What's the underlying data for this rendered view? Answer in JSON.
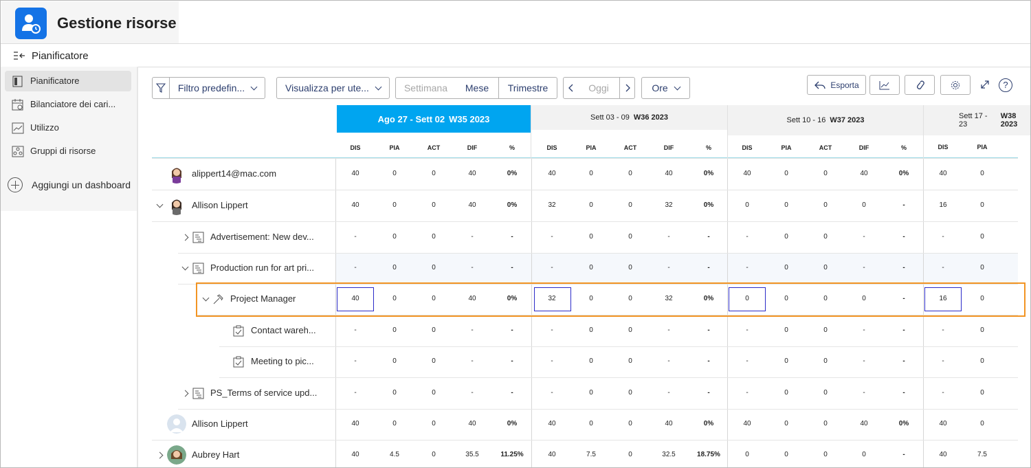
{
  "app": {
    "title": "Gestione risorse",
    "page_title": "Pianificatore"
  },
  "sidebar": {
    "items": [
      {
        "label": "Pianificatore",
        "icon": "planner-icon",
        "active": true
      },
      {
        "label": "Bilanciatore dei cari...",
        "icon": "calendar-icon",
        "active": false
      },
      {
        "label": "Utilizzo",
        "icon": "chart-line-icon",
        "active": false
      },
      {
        "label": "Gruppi di risorse",
        "icon": "resource-groups-icon",
        "active": false
      }
    ],
    "add_dashboard": "Aggiungi un dashboard"
  },
  "toolbar": {
    "filter": "Filtro predefin...",
    "view": "Visualizza per ute...",
    "settimana": "Settimana",
    "mese": "Mese",
    "trimestre": "Trimestre",
    "oggi": "Oggi",
    "unit": "Ore",
    "export": "Esporta"
  },
  "weeks": [
    {
      "range": "Ago 27 - Sett 02",
      "code": "W35 2023",
      "current": true
    },
    {
      "range": "Sett 03 - 09",
      "code": "W36 2023",
      "current": false
    },
    {
      "range": "Sett 10 - 16",
      "code": "W37 2023",
      "current": false
    },
    {
      "range": "Sett 17 - 23",
      "code": "W38 2023",
      "current": false
    }
  ],
  "columns": [
    "DIS",
    "PIA",
    "ACT",
    "DIF",
    "%"
  ],
  "rows": [
    {
      "label": "alippert14@mac.com",
      "type": "user",
      "values": [
        [
          "40",
          "0",
          "0",
          "40",
          "0%"
        ],
        [
          "40",
          "0",
          "0",
          "40",
          "0%"
        ],
        [
          "40",
          "0",
          "0",
          "40",
          "0%"
        ],
        [
          "40",
          "0",
          "",
          "",
          ""
        ]
      ]
    },
    {
      "label": "Allison Lippert",
      "type": "user",
      "values": [
        [
          "40",
          "0",
          "0",
          "40",
          "0%"
        ],
        [
          "32",
          "0",
          "0",
          "32",
          "0%"
        ],
        [
          "0",
          "0",
          "0",
          "0",
          "-"
        ],
        [
          "16",
          "0",
          "",
          "",
          ""
        ]
      ]
    },
    {
      "label": "Advertisement: New dev...",
      "type": "project",
      "values": [
        [
          "-",
          "0",
          "0",
          "-",
          "-"
        ],
        [
          "-",
          "0",
          "0",
          "-",
          "-"
        ],
        [
          "-",
          "0",
          "0",
          "-",
          "-"
        ],
        [
          "-",
          "0",
          "",
          "",
          ""
        ]
      ]
    },
    {
      "label": "Production run for art pri...",
      "type": "project",
      "values": [
        [
          "-",
          "0",
          "0",
          "-",
          "-"
        ],
        [
          "-",
          "0",
          "0",
          "-",
          "-"
        ],
        [
          "-",
          "0",
          "0",
          "-",
          "-"
        ],
        [
          "-",
          "0",
          "",
          "",
          ""
        ]
      ]
    },
    {
      "label": "Project Manager",
      "type": "role",
      "values": [
        [
          "40",
          "0",
          "0",
          "40",
          "0%"
        ],
        [
          "32",
          "0",
          "0",
          "32",
          "0%"
        ],
        [
          "0",
          "0",
          "0",
          "0",
          "-"
        ],
        [
          "16",
          "0",
          "",
          "",
          ""
        ]
      ]
    },
    {
      "label": "Contact wareh...",
      "type": "task",
      "values": [
        [
          "-",
          "0",
          "0",
          "-",
          "-"
        ],
        [
          "-",
          "0",
          "0",
          "-",
          "-"
        ],
        [
          "-",
          "0",
          "0",
          "-",
          "-"
        ],
        [
          "-",
          "0",
          "",
          "",
          ""
        ]
      ]
    },
    {
      "label": "Meeting to pic...",
      "type": "task",
      "values": [
        [
          "-",
          "0",
          "0",
          "-",
          "-"
        ],
        [
          "-",
          "0",
          "0",
          "-",
          "-"
        ],
        [
          "-",
          "0",
          "0",
          "-",
          "-"
        ],
        [
          "-",
          "0",
          "",
          "",
          ""
        ]
      ]
    },
    {
      "label": "PS_Terms of service upd...",
      "type": "project",
      "values": [
        [
          "-",
          "0",
          "0",
          "-",
          "-"
        ],
        [
          "-",
          "0",
          "0",
          "-",
          "-"
        ],
        [
          "-",
          "0",
          "0",
          "-",
          "-"
        ],
        [
          "-",
          "0",
          "",
          "",
          ""
        ]
      ]
    },
    {
      "label": "Allison Lippert",
      "type": "user",
      "values": [
        [
          "40",
          "0",
          "0",
          "40",
          "0%"
        ],
        [
          "40",
          "0",
          "0",
          "40",
          "0%"
        ],
        [
          "40",
          "0",
          "0",
          "40",
          "0%"
        ],
        [
          "40",
          "0",
          "",
          "",
          ""
        ]
      ]
    },
    {
      "label": "Aubrey Hart",
      "type": "user",
      "values": [
        [
          "40",
          "4.5",
          "0",
          "35.5",
          "11.25%"
        ],
        [
          "40",
          "7.5",
          "0",
          "32.5",
          "18.75%"
        ],
        [
          "0",
          "0",
          "0",
          "0",
          "-"
        ],
        [
          "40",
          "7.5",
          "",
          "",
          ""
        ]
      ]
    }
  ]
}
